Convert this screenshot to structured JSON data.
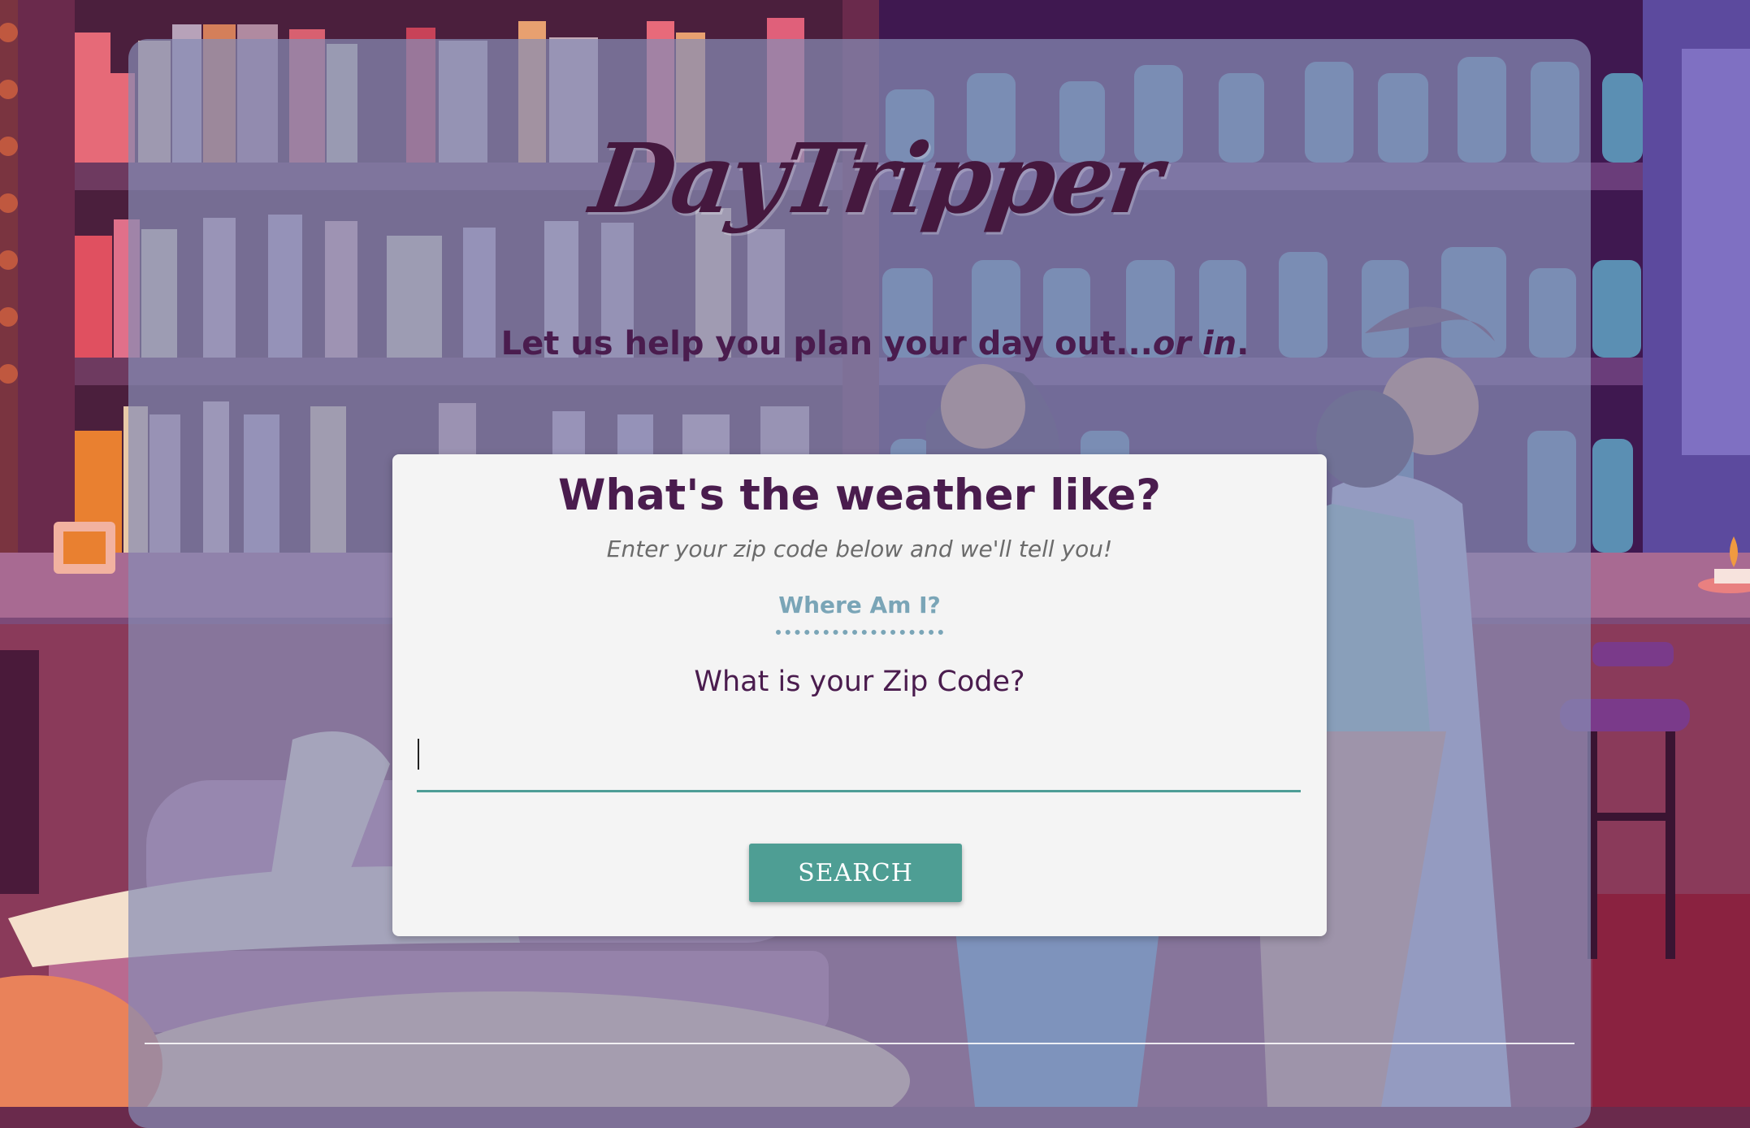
{
  "brand": {
    "logo_text": "DayTripper"
  },
  "hero": {
    "tagline_prefix": "Let us help you plan your day out...",
    "tagline_emphasis": "or in",
    "tagline_suffix": "."
  },
  "weather_card": {
    "title": "What's the weather like?",
    "subtitle": "Enter your zip code below and we'll tell you!",
    "where_am_i_label": "Where Am I?",
    "zip_label": "What is your Zip Code?",
    "zip_value": "",
    "search_label": "SEARCH"
  },
  "colors": {
    "brand_purple": "#4a1c4e",
    "accent_teal": "#4e9e94",
    "link_blue": "#7aa5b7",
    "overlay": "#878cb4"
  },
  "icons": {
    "background": "bar-scene-illustration"
  }
}
